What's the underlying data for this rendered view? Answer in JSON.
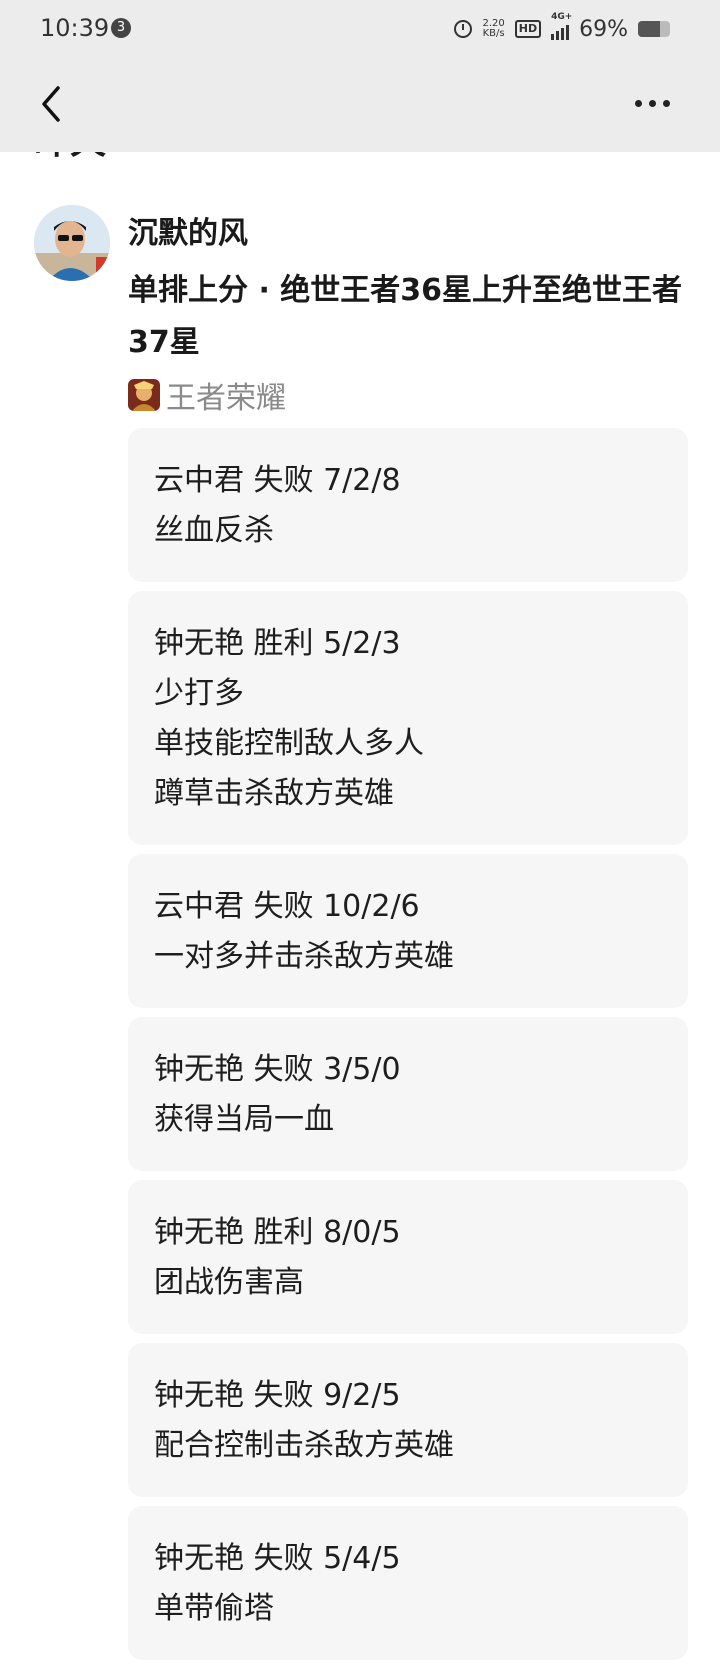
{
  "status_bar": {
    "time": "10:39",
    "notification_count": "3",
    "net_speed_value": "2.20",
    "net_speed_unit": "KB/s",
    "hd_label": "HD",
    "network_label": "4G+",
    "battery_percent": "69%",
    "battery_level": 0.69
  },
  "nav": {
    "back_icon": "chevron-left-icon",
    "more_icon": "more-horizontal-icon"
  },
  "section_heading": "昨天",
  "post": {
    "username": "沉默的风",
    "title": "单排上分 · 绝世王者36星上升至绝世王者37星",
    "game_name": "王者荣耀"
  },
  "matches": [
    {
      "lines": [
        "云中君 失败 7/2/8",
        "丝血反杀"
      ]
    },
    {
      "lines": [
        "钟无艳 胜利 5/2/3",
        "少打多",
        "单技能控制敌人多人",
        "蹲草击杀敌方英雄"
      ]
    },
    {
      "lines": [
        "云中君 失败 10/2/6",
        "一对多并击杀敌方英雄"
      ]
    },
    {
      "lines": [
        "钟无艳 失败 3/5/0",
        "获得当局一血"
      ]
    },
    {
      "lines": [
        "钟无艳 胜利 8/0/5",
        "团战伤害高"
      ]
    },
    {
      "lines": [
        "钟无艳 失败 9/2/5",
        "配合控制击杀敌方英雄"
      ]
    },
    {
      "lines": [
        "钟无艳 失败 5/4/5",
        "单带偷塔"
      ]
    }
  ]
}
